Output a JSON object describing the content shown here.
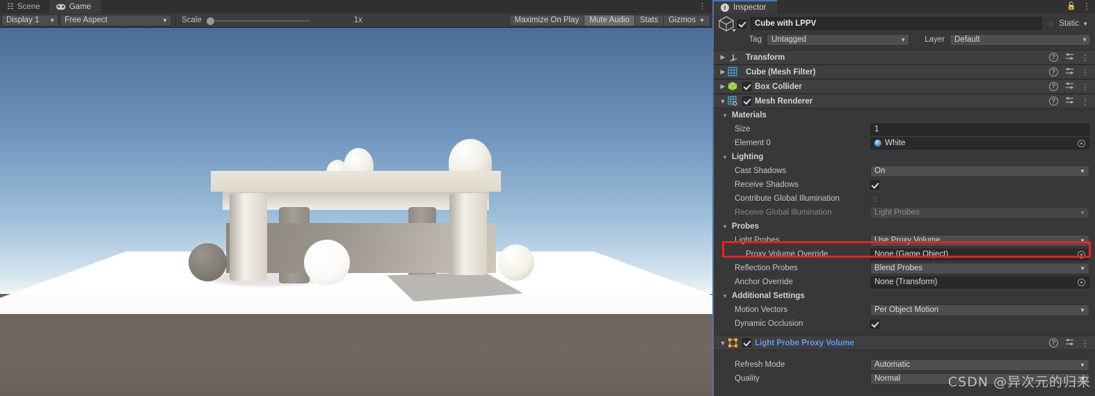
{
  "game_panel": {
    "tabs": [
      {
        "label": "Scene",
        "icon": "grid-icon",
        "active": false
      },
      {
        "label": "Game",
        "icon": "gamepad-icon",
        "active": true
      }
    ],
    "kebab": "⋮",
    "toolbar": {
      "display": "Display 1",
      "aspect": "Free Aspect",
      "scale_label": "Scale",
      "scale_value": "1x",
      "maximize_on_play": "Maximize On Play",
      "mute_audio": "Mute Audio",
      "stats": "Stats",
      "gizmos": "Gizmos",
      "arrow": "▼"
    }
  },
  "inspector": {
    "tab_label": "Inspector",
    "tab_icon": "info-icon",
    "lock_icon": "🔓",
    "kebab": "⋮",
    "object": {
      "name": "Cube with LPPV",
      "enabled": true,
      "static_label": "Static",
      "tag_label": "Tag",
      "tag_value": "Untagged",
      "layer_label": "Layer",
      "layer_value": "Default"
    },
    "components": [
      {
        "name": "Transform",
        "icon": "transform-icon",
        "expanded": false,
        "has_checkbox": false
      },
      {
        "name": "Cube (Mesh Filter)",
        "icon": "mesh-filter-icon",
        "expanded": false,
        "has_checkbox": false
      },
      {
        "name": "Box Collider",
        "icon": "box-collider-icon",
        "expanded": false,
        "has_checkbox": true,
        "checked": true
      },
      {
        "name": "Mesh Renderer",
        "icon": "mesh-renderer-icon",
        "expanded": true,
        "has_checkbox": true,
        "checked": true
      }
    ],
    "mesh_renderer": {
      "materials": {
        "header": "Materials",
        "size_label": "Size",
        "size_value": "1",
        "element0_label": "Element 0",
        "element0_value": "White"
      },
      "lighting": {
        "header": "Lighting",
        "cast_shadows_label": "Cast Shadows",
        "cast_shadows_value": "On",
        "receive_shadows_label": "Receive Shadows",
        "receive_shadows_checked": true,
        "contribute_gi_label": "Contribute Global Illumination",
        "contribute_gi_checked": false,
        "receive_gi_label": "Receive Global Illumination",
        "receive_gi_value": "Light Probes"
      },
      "probes": {
        "header": "Probes",
        "light_probes_label": "Light Probes",
        "light_probes_value": "Use Proxy Volume",
        "proxy_volume_override_label": "Proxy Volume Override",
        "proxy_volume_override_value": "None (Game Object)",
        "reflection_probes_label": "Reflection Probes",
        "reflection_probes_value": "Blend Probes",
        "anchor_override_label": "Anchor Override",
        "anchor_override_value": "None (Transform)"
      },
      "additional": {
        "header": "Additional Settings",
        "motion_vectors_label": "Motion Vectors",
        "motion_vectors_value": "Per Object Motion",
        "dynamic_occlusion_label": "Dynamic Occlusion",
        "dynamic_occlusion_checked": true
      }
    },
    "lppv_component": {
      "name": "Light Probe Proxy Volume",
      "icon": "lppv-icon",
      "checked": true,
      "refresh_mode_label": "Refresh Mode",
      "refresh_mode_value": "Automatic",
      "quality_label": "Quality",
      "quality_value": "Normal"
    },
    "highlight_color": "#f01f1f"
  },
  "watermark": "CSDN @异次元的归来"
}
